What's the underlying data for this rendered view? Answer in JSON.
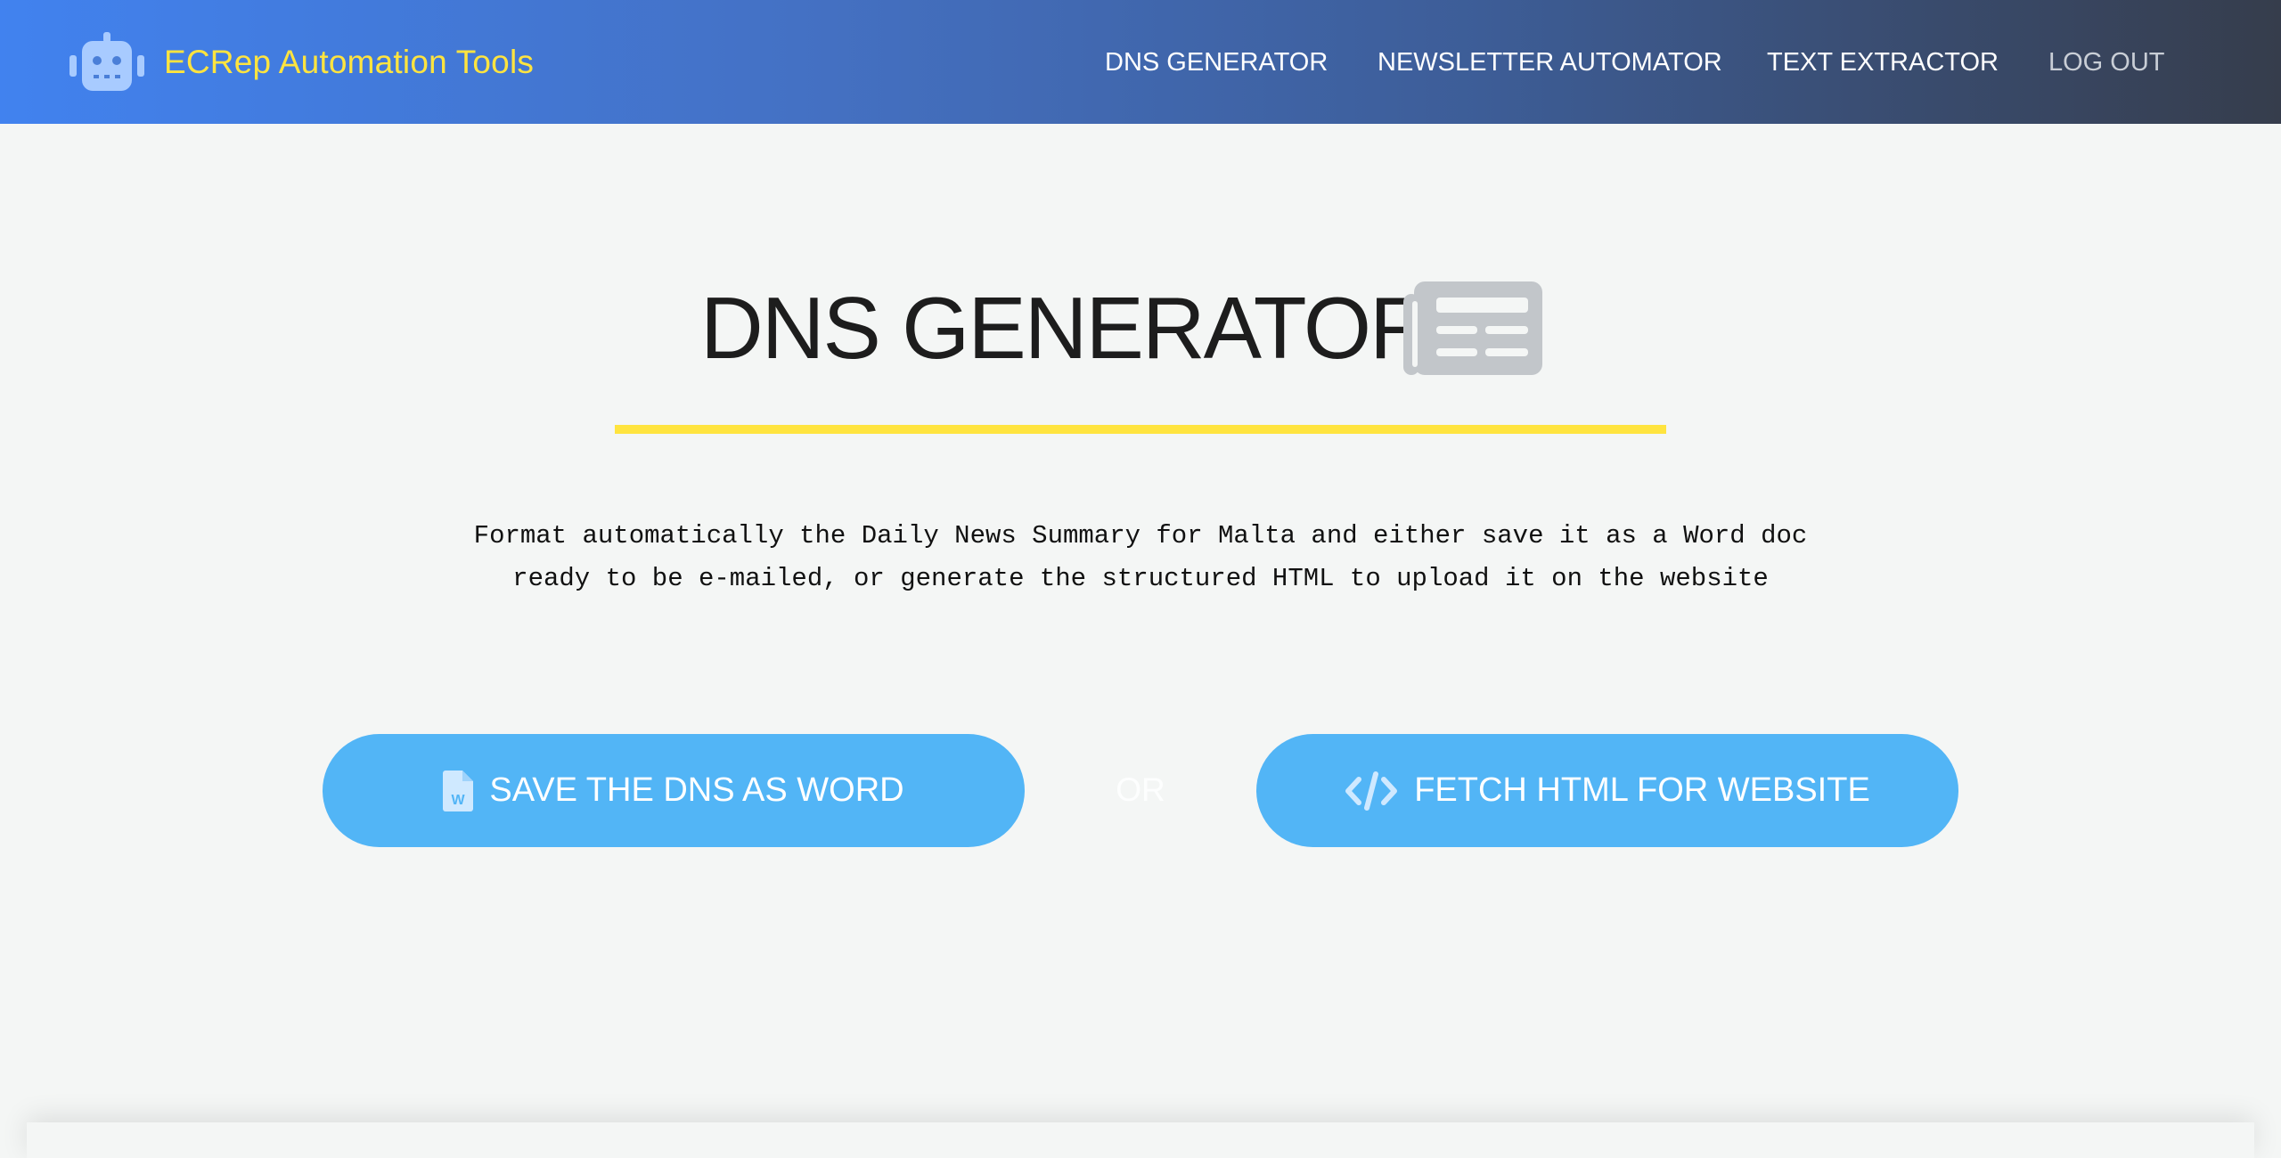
{
  "header": {
    "brand": "ECRep Automation Tools",
    "brand_color": "#ffe43f",
    "brand_icon": "robot-icon",
    "nav": {
      "dns_generator": "DNS GENERATOR",
      "newsletter_automator": "NEWSLETTER AUTOMATOR",
      "text_extractor": "TEXT EXTRACTOR",
      "log_out": "LOG OUT"
    }
  },
  "main": {
    "title": "DNS GENERATOR",
    "title_icon": "newspaper-icon",
    "accent_color": "#ffe43f",
    "description_line1": "Format automatically the Daily News Summary for Malta and either save it as a Word doc",
    "description_line2": "ready to be e-mailed, or generate the structured HTML to upload it on the website",
    "button_color": "#52b5f6",
    "save_word_button": "SAVE THE DNS AS WORD",
    "save_word_icon": "word-file-icon",
    "or_separator": "OR",
    "fetch_html_button": "FETCH HTML FOR WEBSITE",
    "fetch_html_icon": "code-icon"
  }
}
